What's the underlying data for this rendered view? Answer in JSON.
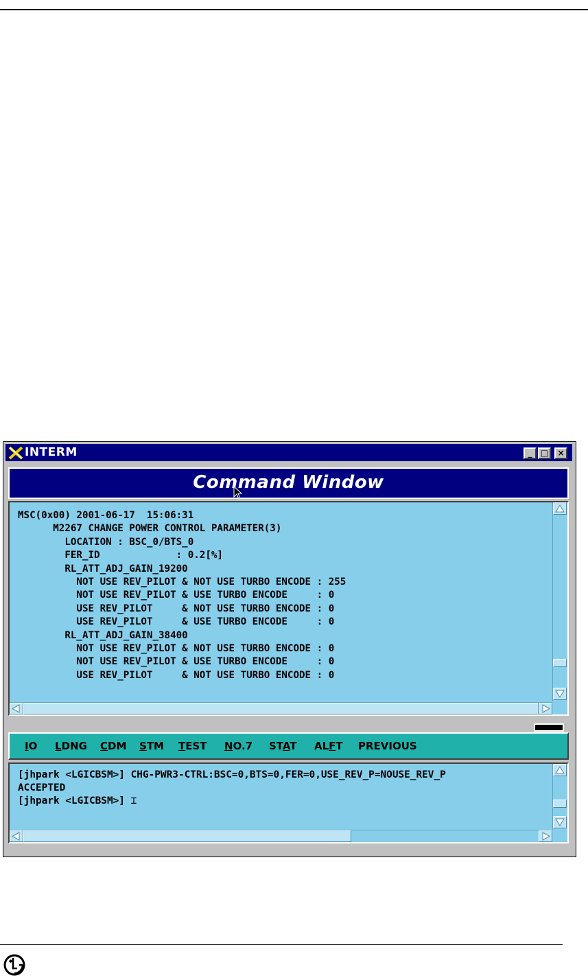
{
  "window": {
    "title": "INTERM",
    "controls": {
      "minimize": "_",
      "maximize": "□",
      "close": "×"
    }
  },
  "command_window": {
    "header": "Command Window",
    "output_lines": [
      "MSC(0x00) 2001-06-17  15:06:31",
      "      M2267 CHANGE POWER CONTROL PARAMETER(3)",
      "        LOCATION : BSC_0/BTS_0",
      "        FER_ID             : 0.2[%]",
      "        RL_ATT_ADJ_GAIN_19200",
      "          NOT USE REV_PILOT & NOT USE TURBO ENCODE : 255",
      "          NOT USE REV_PILOT & USE TURBO ENCODE     : 0",
      "          USE REV_PILOT     & NOT USE TURBO ENCODE : 0",
      "          USE REV_PILOT     & USE TURBO ENCODE     : 0",
      "        RL_ATT_ADJ_GAIN_38400",
      "          NOT USE REV_PILOT & NOT USE TURBO ENCODE : 0",
      "          NOT USE REV_PILOT & USE TURBO ENCODE     : 0",
      "          USE REV_PILOT     & NOT USE TURBO ENCODE : 0"
    ]
  },
  "menu": [
    {
      "pre": "",
      "u": "I",
      "post": "O"
    },
    {
      "pre": "",
      "u": "L",
      "post": "DNG"
    },
    {
      "pre": "",
      "u": "C",
      "post": "DM"
    },
    {
      "pre": "",
      "u": "S",
      "post": "TM"
    },
    {
      "pre": "",
      "u": "T",
      "post": "EST"
    },
    {
      "pre": "",
      "u": "N",
      "post": "O.7"
    },
    {
      "pre": "ST",
      "u": "A",
      "post": "T"
    },
    {
      "pre": "AL",
      "u": "F",
      "post": "T"
    },
    {
      "pre": "PREVIOUS",
      "u": "",
      "post": ""
    }
  ],
  "input_window": {
    "lines": [
      "[jhpark <LGICBSM>] CHG-PWR3-CTRL:BSC=0,BTS=0,FER=0,USE_REV_P=NOUSE_REV_P",
      "ACCEPTED",
      "[jhpark <LGICBSM>] "
    ]
  },
  "footer": {
    "logo_icon": "lg-logo-icon"
  },
  "colors": {
    "text_bg": "#87ceeb",
    "menu_bg": "#20b2aa",
    "title_bg": "#000080"
  }
}
